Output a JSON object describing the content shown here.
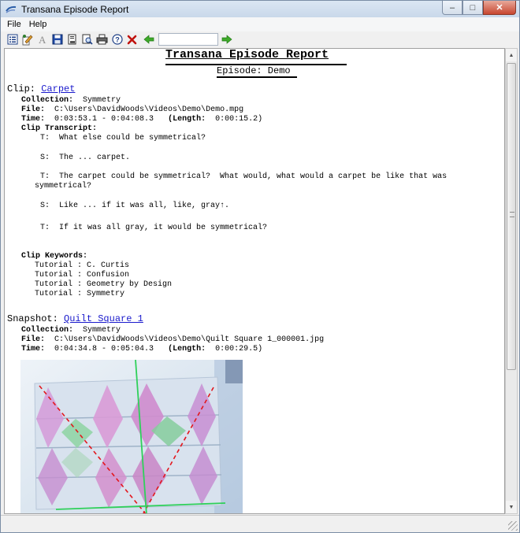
{
  "window": {
    "title": "Transana Episode Report"
  },
  "menu": {
    "file": "File",
    "help": "Help"
  },
  "toolbar": {
    "search_value": ""
  },
  "report": {
    "title": "Transana Episode Report",
    "subtitle": "Episode: Demo"
  },
  "clip": {
    "heading": "Clip:",
    "name": "Carpet",
    "collection_label": "Collection:",
    "collection": "Symmetry",
    "file_label": "File:",
    "file": "C:\\Users\\DavidWoods\\Videos\\Demo\\Demo.mpg",
    "time_label": "Time:",
    "time": "0:03:53.1 - 0:04:08.3",
    "length_label": "(Length:",
    "length": "0:00:15.2)",
    "transcript_label": "Clip Transcript:",
    "transcript": [
      "T:  What else could be symmetrical?",
      "S:  The ... carpet.",
      "T:  The carpet could be symmetrical?  What would, what would a carpet be like that was",
      "symmetrical?",
      "S:  Like ... if it was all, like, gray↑.",
      "T:  If it was all gray, it would be symmetrical?"
    ],
    "keywords_label": "Clip Keywords:",
    "keywords": [
      "Tutorial : C. Curtis",
      "Tutorial : Confusion",
      "Tutorial : Geometry by Design",
      "Tutorial : Symmetry"
    ]
  },
  "snapshot": {
    "heading": "Snapshot:",
    "name": "Quilt Square 1",
    "collection_label": "Collection:",
    "collection": "Symmetry",
    "file_label": "File:",
    "file": "C:\\Users\\DavidWoods\\Videos\\Demo\\Quilt Square 1_000001.jpg",
    "time_label": "Time:",
    "time": "0:04:34.8 - 0:05:04.3",
    "length_label": "(Length:",
    "length": "0:00:29.5)"
  }
}
